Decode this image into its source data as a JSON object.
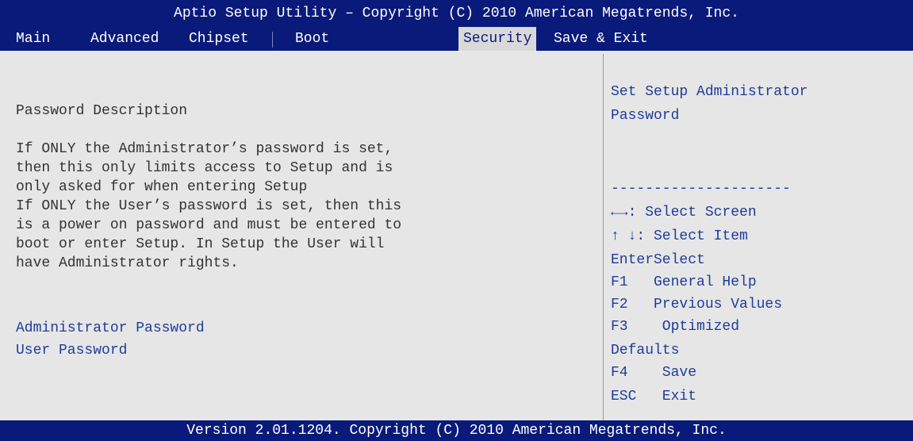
{
  "title": "Aptio Setup Utility – Copyright (C) 2010 American Megatrends, Inc.",
  "tabs": [
    {
      "label": "Main"
    },
    {
      "label": "Advanced"
    },
    {
      "label": "Chipset"
    },
    {
      "label": "Boot"
    },
    {
      "label": "Security"
    },
    {
      "label": "Save & Exit"
    }
  ],
  "main": {
    "section_title": "Password Description",
    "description": [
      "If ONLY the Administrator’s password is set,",
      "then this only limits access to Setup and is",
      "only asked for when entering Setup",
      "If ONLY the User’s password is set, then this",
      "is a power on password and must be entered to",
      "boot or enter Setup. In Setup the User will",
      "have Administrator rights."
    ],
    "admin_password_label": "Administrator Password",
    "user_password_label": "User Password"
  },
  "help": {
    "description": [
      "Set Setup Administrator",
      "Password"
    ],
    "divider": "---------------------",
    "keys": [
      "←→: Select Screen",
      "↑ ↓: Select Item",
      "EnterSelect",
      "F1   General Help",
      "F2   Previous Values",
      "F3    Optimized",
      "Defaults",
      "F4    Save",
      "ESC   Exit"
    ]
  },
  "footer": "Version 2.01.1204. Copyright (C) 2010 American Megatrends, Inc.",
  "colors": {
    "header_bg": "#0a1a7a",
    "panel_bg": "#e6e6e6",
    "active_tab_bg": "#d9d9d9",
    "item_text": "#1f3c9a",
    "body_text": "#333333"
  }
}
